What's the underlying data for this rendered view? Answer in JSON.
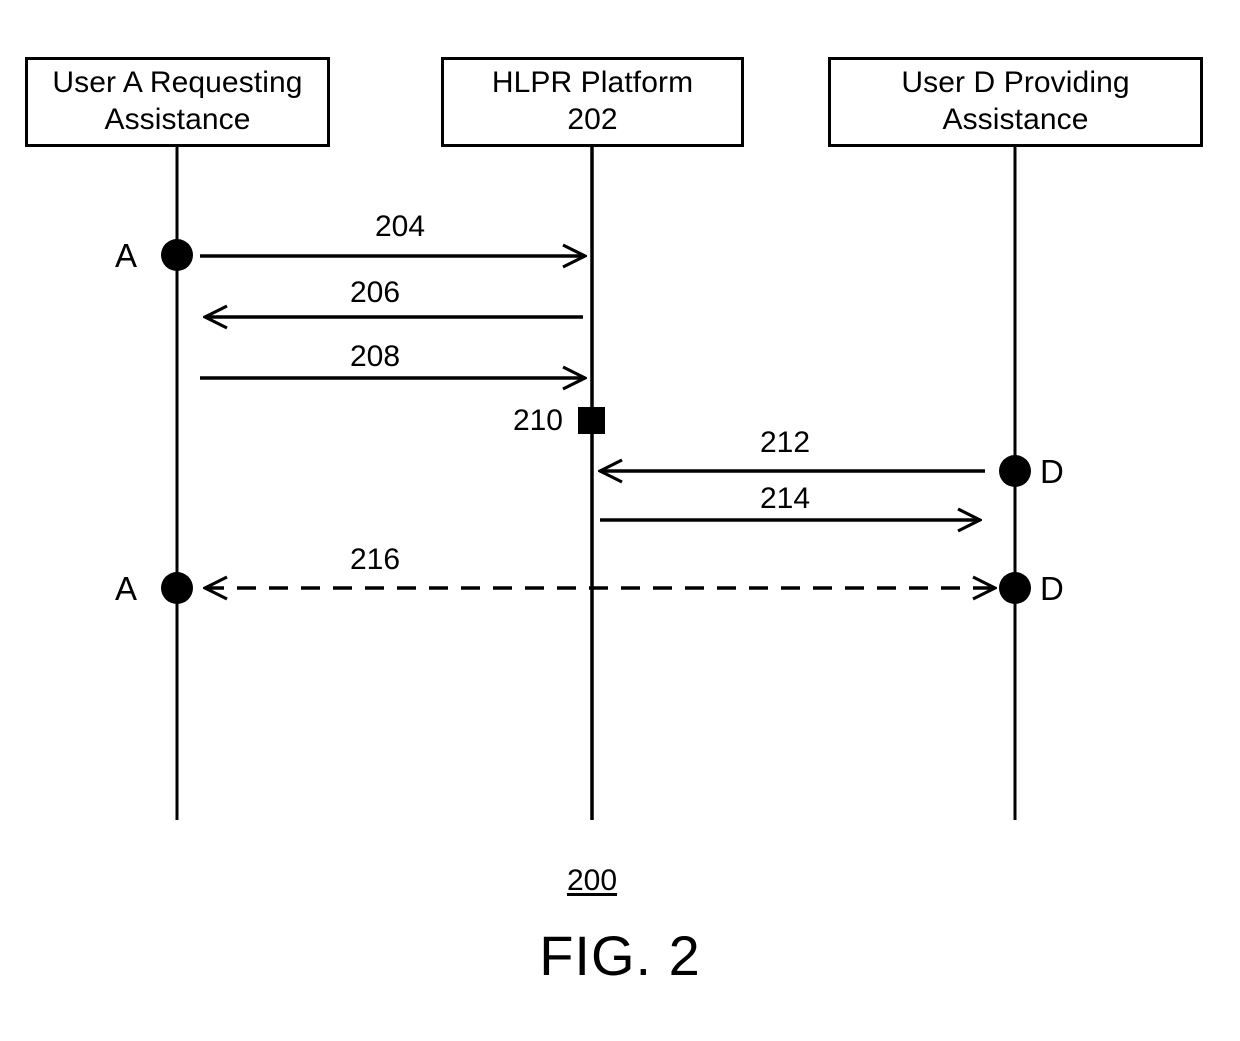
{
  "figure": {
    "caption": "FIG. 2",
    "reference_numeral": "200"
  },
  "participants": [
    {
      "id": "user-a",
      "title_line1": "User A Requesting",
      "title_line2": "Assistance",
      "actor_letter_top": "A",
      "actor_letter_bottom": "A"
    },
    {
      "id": "hlpr-platform",
      "title_line1": "HLPR Platform",
      "title_line2": "202"
    },
    {
      "id": "user-d",
      "title_line1": "User D Providing",
      "title_line2": "Assistance",
      "actor_letter_top": "D",
      "actor_letter_bottom": "D"
    }
  ],
  "messages": [
    {
      "id": "msg-204",
      "label": "204",
      "from": "user-a",
      "to": "hlpr-platform",
      "direction": "right",
      "style": "solid"
    },
    {
      "id": "msg-206",
      "label": "206",
      "from": "hlpr-platform",
      "to": "user-a",
      "direction": "left",
      "style": "solid"
    },
    {
      "id": "msg-208",
      "label": "208",
      "from": "user-a",
      "to": "hlpr-platform",
      "direction": "right",
      "style": "solid"
    },
    {
      "id": "msg-210",
      "label": "210",
      "from": "hlpr-platform",
      "to": "hlpr-platform",
      "direction": "self",
      "style": "marker"
    },
    {
      "id": "msg-212",
      "label": "212",
      "from": "user-d",
      "to": "hlpr-platform",
      "direction": "left",
      "style": "solid"
    },
    {
      "id": "msg-214",
      "label": "214",
      "from": "hlpr-platform",
      "to": "user-d",
      "direction": "right",
      "style": "solid"
    },
    {
      "id": "msg-216",
      "label": "216",
      "from": "user-a",
      "to": "user-d",
      "direction": "both",
      "style": "dashed"
    }
  ],
  "colors": {
    "stroke": "#000000",
    "background": "#ffffff"
  }
}
